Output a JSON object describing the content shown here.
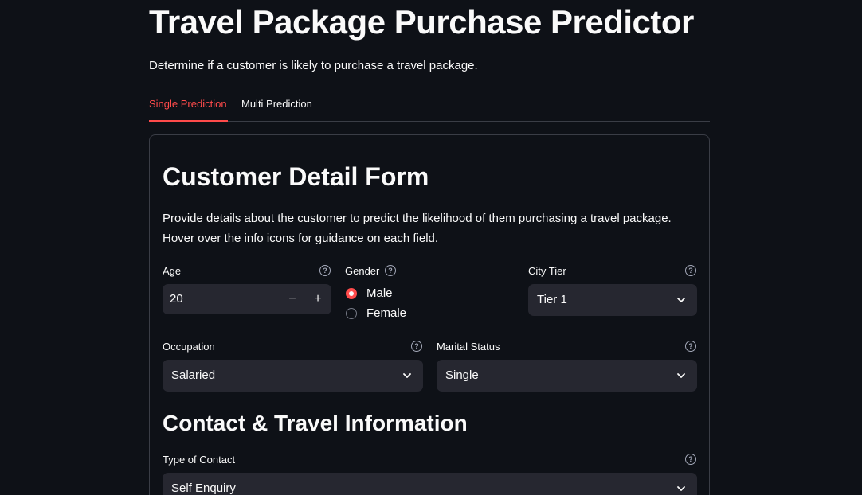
{
  "header": {
    "title": "Travel Package Purchase Predictor",
    "subtitle": "Determine if a customer is likely to purchase a travel package."
  },
  "tabs": [
    {
      "label": "Single Prediction",
      "active": true
    },
    {
      "label": "Multi Prediction",
      "active": false
    }
  ],
  "form": {
    "title": "Customer Detail Form",
    "description_line1": "Provide details about the customer to predict the likelihood of them purchasing a travel package.",
    "description_line2": "Hover over the info icons for guidance on each field.",
    "age": {
      "label": "Age",
      "value": "20",
      "decrement": "−",
      "increment": "+"
    },
    "gender": {
      "label": "Gender",
      "options": [
        {
          "label": "Male",
          "selected": true
        },
        {
          "label": "Female",
          "selected": false
        }
      ]
    },
    "city_tier": {
      "label": "City Tier",
      "value": "Tier 1"
    },
    "occupation": {
      "label": "Occupation",
      "value": "Salaried"
    },
    "marital_status": {
      "label": "Marital Status",
      "value": "Single"
    },
    "contact_section_title": "Contact & Travel Information",
    "type_of_contact": {
      "label": "Type of Contact",
      "value": "Self Enquiry"
    }
  },
  "icons": {
    "help": "question-circle-icon",
    "chevron": "chevron-down-icon"
  },
  "colors": {
    "background": "#0e1117",
    "accent": "#ff4b4b",
    "input_bg": "#262730",
    "text": "#fafafa",
    "border": "#3a3d46"
  }
}
